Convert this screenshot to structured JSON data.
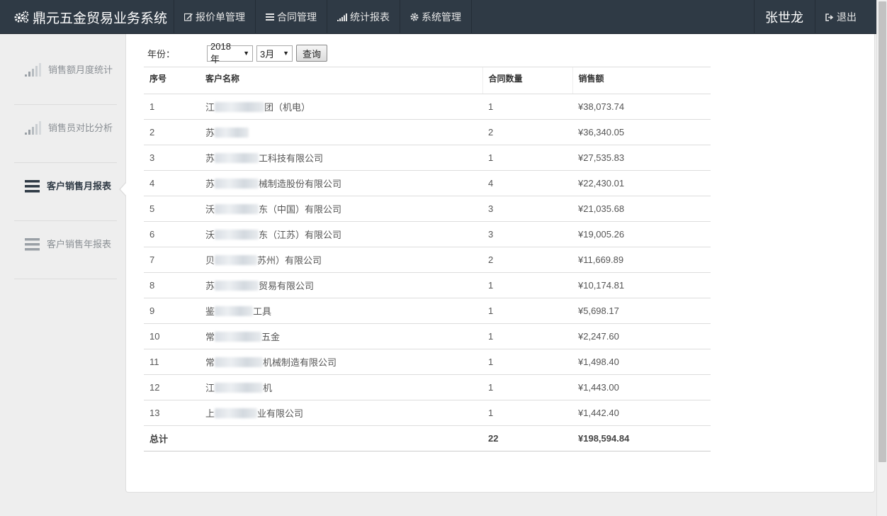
{
  "app": {
    "brand": "鼎元五金贸易业务系统",
    "nav": [
      {
        "icon": "edit-icon",
        "label": "报价单管理"
      },
      {
        "icon": "list-icon",
        "label": "合同管理"
      },
      {
        "icon": "signal-icon",
        "label": "统计报表"
      },
      {
        "icon": "gear-icon",
        "label": "系统管理"
      }
    ],
    "user": "张世龙",
    "logout": "退出"
  },
  "sidebar": {
    "items": [
      {
        "label": "销售额月度统计",
        "icon": "signal-icon",
        "active": false
      },
      {
        "label": "销售员对比分析",
        "icon": "signal-icon",
        "active": false
      },
      {
        "label": "客户销售月报表",
        "icon": "list-icon",
        "active": true
      },
      {
        "label": "客户销售年报表",
        "icon": "list-icon",
        "active": false
      }
    ]
  },
  "filter": {
    "year_label": "年份：",
    "year": "2018年",
    "month": "3月",
    "query_label": "查询"
  },
  "table": {
    "headers": [
      "序号",
      "客户名称",
      "合同数量",
      "销售额"
    ],
    "rows": [
      {
        "no": "1",
        "name_start": "江",
        "name_end": "团（机电）",
        "count": "1",
        "amount": "¥38,073.74"
      },
      {
        "no": "2",
        "name_start": "苏",
        "name_end": "",
        "count": "2",
        "amount": "¥36,340.05"
      },
      {
        "no": "3",
        "name_start": "苏",
        "name_end": "工科技有限公司",
        "count": "1",
        "amount": "¥27,535.83"
      },
      {
        "no": "4",
        "name_start": "苏",
        "name_end": "械制造股份有限公司",
        "count": "4",
        "amount": "¥22,430.01"
      },
      {
        "no": "5",
        "name_start": "沃",
        "name_end": "东（中国）有限公司",
        "count": "3",
        "amount": "¥21,035.68"
      },
      {
        "no": "6",
        "name_start": "沃",
        "name_end": "东（江苏）有限公司",
        "count": "3",
        "amount": "¥19,005.26"
      },
      {
        "no": "7",
        "name_start": "贝",
        "name_end": "苏州）有限公司",
        "count": "2",
        "amount": "¥11,669.89"
      },
      {
        "no": "8",
        "name_start": "苏",
        "name_end": "贸易有限公司",
        "count": "1",
        "amount": "¥10,174.81"
      },
      {
        "no": "9",
        "name_start": "鉴",
        "name_end": "工具",
        "count": "1",
        "amount": "¥5,698.17"
      },
      {
        "no": "10",
        "name_start": "常",
        "name_end": "五金",
        "count": "1",
        "amount": "¥2,247.60"
      },
      {
        "no": "11",
        "name_start": "常",
        "name_end": "机械制造有限公司",
        "count": "1",
        "amount": "¥1,498.40"
      },
      {
        "no": "12",
        "name_start": "江",
        "name_end": "机",
        "count": "1",
        "amount": "¥1,443.00"
      },
      {
        "no": "13",
        "name_start": "上",
        "name_end": "业有限公司",
        "count": "1",
        "amount": "¥1,442.40"
      }
    ],
    "total": {
      "label": "总计",
      "count": "22",
      "amount": "¥198,594.84"
    }
  },
  "colors": {
    "navbar": "#2f3a45",
    "active_text": "#2f3a45",
    "muted_text": "#8a8f94"
  }
}
